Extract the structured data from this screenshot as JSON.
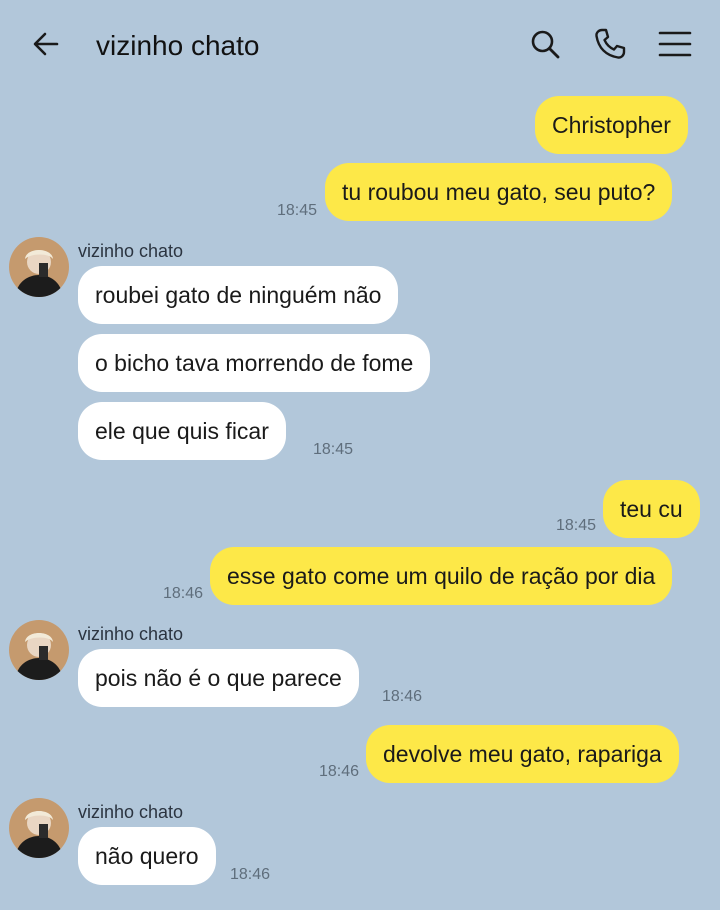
{
  "header": {
    "title": "vizinho chato",
    "back_icon": "arrow-left-icon",
    "search_icon": "search-icon",
    "call_icon": "phone-icon",
    "menu_icon": "menu-icon"
  },
  "colors": {
    "background": "#b2c7da",
    "outgoing_bubble": "#fde848",
    "incoming_bubble": "#ffffff"
  },
  "messages": [
    {
      "direction": "out",
      "text": "Christopher"
    },
    {
      "direction": "out",
      "text": "tu roubou meu gato, seu puto?",
      "time": "18:45"
    },
    {
      "direction": "in",
      "sender": "vizinho chato",
      "text": "roubei gato de ninguém não"
    },
    {
      "direction": "in",
      "text": "o bicho tava morrendo de fome"
    },
    {
      "direction": "in",
      "text": "ele que quis ficar",
      "time": "18:45"
    },
    {
      "direction": "out",
      "text": "teu cu",
      "time": "18:45"
    },
    {
      "direction": "out",
      "text": "esse gato come um quilo de ração por dia",
      "time": "18:46"
    },
    {
      "direction": "in",
      "sender": "vizinho chato",
      "text": "pois não é o que parece",
      "time": "18:46"
    },
    {
      "direction": "out",
      "text": "devolve meu gato, rapariga",
      "time": "18:46"
    },
    {
      "direction": "in",
      "sender": "vizinho chato",
      "text": "não quero",
      "time": "18:46"
    }
  ]
}
